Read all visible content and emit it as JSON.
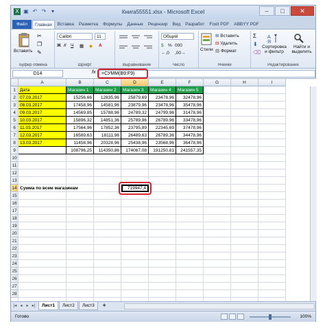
{
  "window": {
    "title": "Книга55551.xlsx - Microsoft Excel",
    "min": "–",
    "max": "□",
    "close": "✕"
  },
  "ribbon_tabs": [
    "Файл",
    "Главная",
    "Вставка",
    "Разметка",
    "Формулы",
    "Данные",
    "Рецензир",
    "Вид",
    "Разработ",
    "Foxit PDF",
    "ABBYY PDF"
  ],
  "ribbon": {
    "paste_label": "Вставить",
    "font_name": "Calibri",
    "font_size": "11",
    "number_format": "Общий",
    "insert_label": "Вставить",
    "delete_label": "Удалить",
    "format_label": "Формат",
    "styles_label": "Стили",
    "sort_label": "Сортировка и фильтр",
    "find_label": "Найти и выделить",
    "groups": {
      "clipboard": "Буфер обмена",
      "font": "Шрифт",
      "alignment": "Выравнивание",
      "number": "Число",
      "cells": "Ячейки",
      "editing": "Редактирование"
    }
  },
  "formula_bar": {
    "name_box": "D14",
    "fx": "fx",
    "formula": "=СУММ(B9:F9)"
  },
  "columns": [
    "A",
    "B",
    "C",
    "D",
    "E",
    "F",
    "G",
    "H",
    "I"
  ],
  "rows": [
    "1",
    "2",
    "3",
    "4",
    "5",
    "6",
    "7",
    "8",
    "9",
    "10",
    "11",
    "12",
    "13",
    "14",
    "15",
    "16",
    "17",
    "18",
    "19",
    "20",
    "21",
    "22",
    "23",
    "24",
    "25",
    "26",
    "27",
    "28"
  ],
  "sheet": {
    "headers": [
      "Дата",
      "Магазин 1",
      "Магазин 2",
      "Магазин 3",
      "Магазин 4",
      "Магазин 5"
    ],
    "data": [
      [
        "07.03.2017",
        "15256,66",
        "12835,96",
        "25879,69",
        "23478,96",
        "32478,96"
      ],
      [
        "08.03.2017",
        "17458,96",
        "14581,96",
        "23879,96",
        "23478,96",
        "35478,96"
      ],
      [
        "09.03.2017",
        "14569,85",
        "15788,96",
        "24789,32",
        "24799,96",
        "31478,96"
      ],
      [
        "10.03.2017",
        "15896,32",
        "14851,36",
        "25789,96",
        "26789,96",
        "33478,96"
      ],
      [
        "11.03.2017",
        "17564,96",
        "17852,36",
        "23795,89",
        "22345,69",
        "37478,96"
      ],
      [
        "12.03.2017",
        "16589,63",
        "18111,96",
        "26489,63",
        "26789,36",
        "34478,96"
      ],
      [
        "13.03.2017",
        "11458,96",
        "20328,96",
        "25438,96",
        "23568,96",
        "36478,96"
      ]
    ],
    "totals": [
      "",
      "108796,25",
      "114350,86",
      "174067,08",
      "191250,81",
      "241557,35"
    ],
    "summary_label": "Сумма по всем магазинам",
    "summary_value": "719947,4"
  },
  "sheet_tabs": [
    "Лист1",
    "Лист2",
    "Лист3"
  ],
  "status": {
    "ready": "Готово",
    "zoom": "100%"
  }
}
